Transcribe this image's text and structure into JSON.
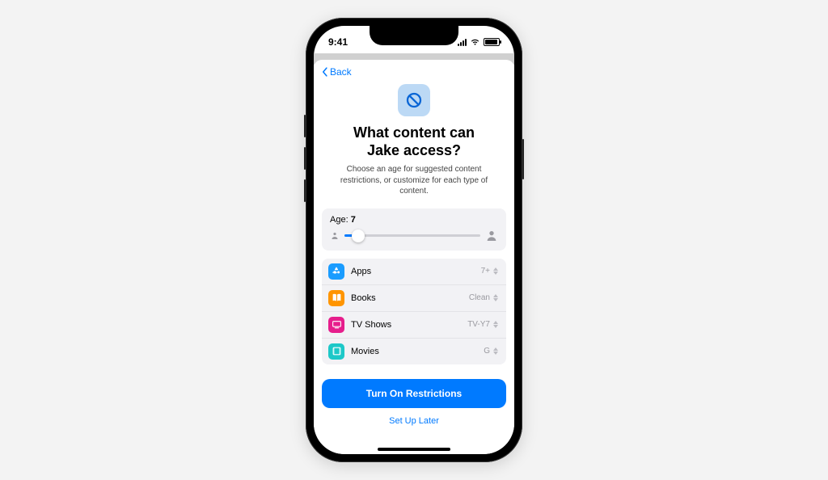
{
  "status": {
    "time": "9:41"
  },
  "nav": {
    "back_label": "Back"
  },
  "hero": {
    "title_line1": "What content can",
    "title_line2": "Jake access?",
    "subtitle": "Choose an age for suggested content restrictions, or customize for each type of content."
  },
  "age": {
    "label": "Age:",
    "value": "7",
    "slider_percent": 10
  },
  "categories": [
    {
      "name": "Apps",
      "value": "7+",
      "icon": "apps-icon",
      "color": "#1a9cff"
    },
    {
      "name": "Books",
      "value": "Clean",
      "icon": "books-icon",
      "color": "#ff9500"
    },
    {
      "name": "TV Shows",
      "value": "TV-Y7",
      "icon": "tvshows-icon",
      "color": "#e61e8c"
    },
    {
      "name": "Movies",
      "value": "G",
      "icon": "movies-icon",
      "color": "#1dc8c8"
    }
  ],
  "buttons": {
    "primary": "Turn On Restrictions",
    "secondary": "Set Up Later"
  }
}
